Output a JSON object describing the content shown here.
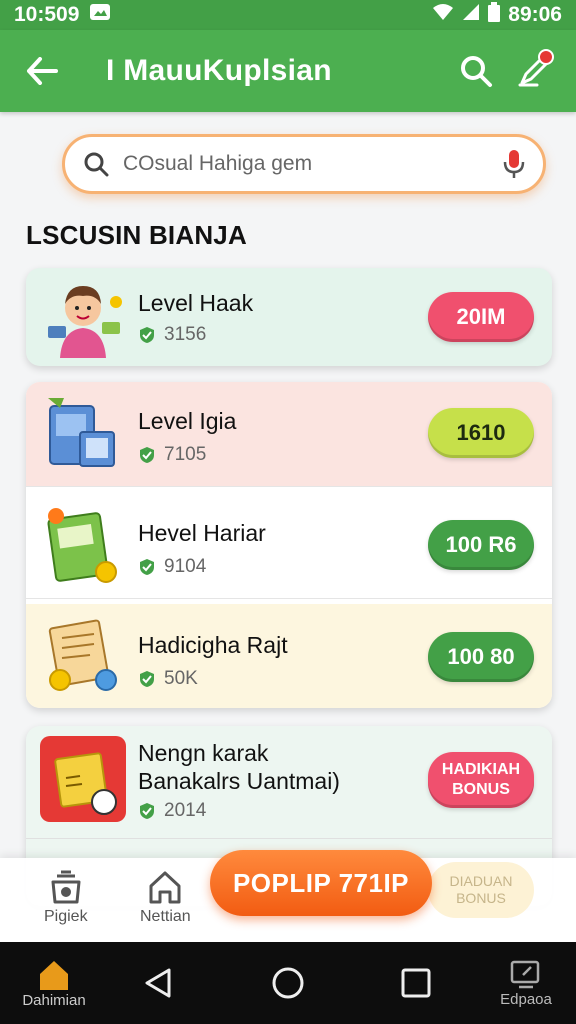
{
  "status_bar": {
    "time": "10:509",
    "clock": "89:06"
  },
  "app_bar": {
    "title": "I MauuKuplsian"
  },
  "search": {
    "placeholder": "COsual Hahiga gem"
  },
  "section": {
    "title": "LSCUSIN BIANJA"
  },
  "items": [
    {
      "title": "Level Haak",
      "sub": "3156",
      "badge": "20IM",
      "badge_color": "#f0506e"
    },
    {
      "title": "Level Igia",
      "sub": "7105",
      "badge": "1610",
      "badge_color": "#c6e04a"
    },
    {
      "title": "Hevel Hariar",
      "sub": "9104",
      "badge": "100 R6",
      "badge_color": "#43a047"
    },
    {
      "title": "Hadicigha Rajt",
      "sub": "50K",
      "badge": "100 80",
      "badge_color": "#43a047"
    },
    {
      "title": "Nengn karak",
      "title2": "Banakalrs Uantmai)",
      "sub": "2014",
      "badge": "HADIKIAH BONUS",
      "badge_color": "#f0506e"
    }
  ],
  "bottom_nav": {
    "item1": "Pigiek",
    "item2": "Nettian",
    "popular": "POPLIP 771IP",
    "ghost": "DIADUAN BONUS"
  },
  "system_nav": {
    "left": "Dahimian",
    "right": "Edpaoa"
  },
  "colors": {
    "primary": "#4caf50",
    "accent": "#f25c12"
  }
}
